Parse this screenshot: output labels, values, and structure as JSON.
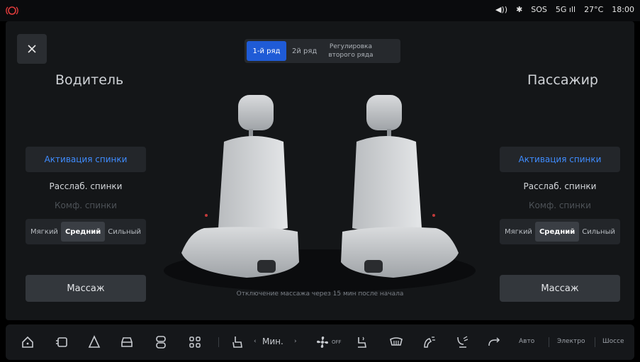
{
  "status": {
    "volume_icon": "volume-icon",
    "bluetooth_icon": "bluetooth-icon",
    "sos": "SOS",
    "network": "5G",
    "temperature": "27°C",
    "time": "18:00"
  },
  "tabs": [
    {
      "label": "1-й ряд",
      "active": true
    },
    {
      "label": "2й ряд",
      "active": false
    },
    {
      "label": "Регулировка\nвторого ряда",
      "active": false
    }
  ],
  "driver": {
    "title": "Водитель",
    "activate": "Активация спинки",
    "relax": "Расслаб. спинки",
    "comfort": "Комф. спинки",
    "intensity": [
      "Мягкий",
      "Средний",
      "Сильный"
    ],
    "selected_intensity": "Средний",
    "massage": "Массаж"
  },
  "passenger": {
    "title": "Пассажир",
    "activate": "Активация спинки",
    "relax": "Расслаб. спинки",
    "comfort": "Комф. спинки",
    "intensity": [
      "Мягкий",
      "Средний",
      "Сильный"
    ],
    "selected_intensity": "Средний",
    "massage": "Массаж"
  },
  "note": "Отключение массажа через 15 мин после начала",
  "dock": {
    "fan_level": "Мин.",
    "fan_state": "OFF",
    "mode_auto": "Авто",
    "mode_electro": "Электро",
    "mode_highway": "Шоссе"
  },
  "colors": {
    "accent": "#1f5bd6",
    "accent_text": "#3f8cff",
    "panel": "#141618"
  }
}
